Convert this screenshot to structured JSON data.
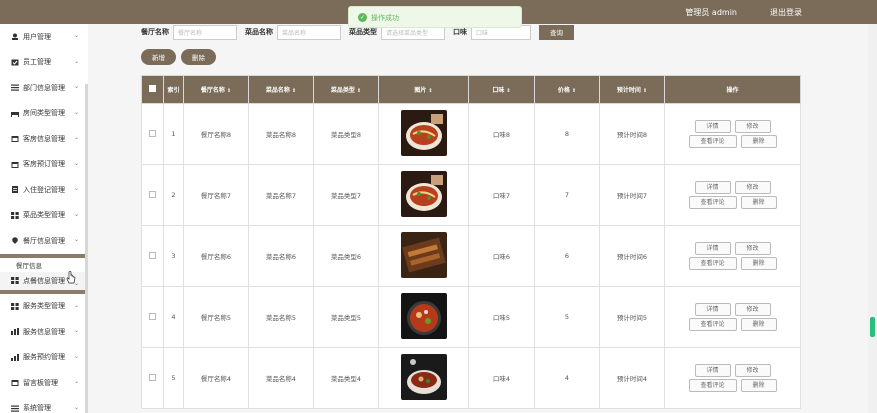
{
  "header": {
    "user_label": "管理员 admin",
    "logout_label": "退出登录"
  },
  "toast": {
    "message": "操作成功"
  },
  "sidebar": {
    "items": [
      {
        "label": "用户管理",
        "icon": "user-icon"
      },
      {
        "label": "员工管理",
        "icon": "check-icon"
      },
      {
        "label": "部门信息管理",
        "icon": "list-icon"
      },
      {
        "label": "房间类型管理",
        "icon": "bed-icon"
      },
      {
        "label": "客房信息管理",
        "icon": "calendar-icon"
      },
      {
        "label": "客房预订管理",
        "icon": "calendar-icon"
      },
      {
        "label": "入住登记管理",
        "icon": "doc-icon"
      },
      {
        "label": "菜品类型管理",
        "icon": "grid-icon"
      },
      {
        "label": "餐厅信息管理",
        "icon": "pin-icon"
      }
    ],
    "submenu": [
      {
        "label": "餐厅信息"
      }
    ],
    "active": {
      "label": "点餐信息管理",
      "icon": "grid-icon"
    },
    "items_after": [
      {
        "label": "服务类型管理",
        "icon": "grid-icon"
      },
      {
        "label": "服务信息管理",
        "icon": "chart-icon"
      },
      {
        "label": "服务预约管理",
        "icon": "bar-icon"
      },
      {
        "label": "留言板管理",
        "icon": "calendar-icon"
      },
      {
        "label": "系统管理",
        "icon": "list-icon"
      }
    ]
  },
  "search": {
    "fields": [
      {
        "label": "餐厅名称",
        "placeholder": "餐厅名称"
      },
      {
        "label": "菜品名称",
        "placeholder": "菜品名称"
      },
      {
        "label": "菜品类型",
        "placeholder": "请选择菜品类型"
      },
      {
        "label": "口味",
        "placeholder": "口味"
      }
    ],
    "button_label": "查询"
  },
  "actions": {
    "add_label": "新增",
    "delete_label": "删除"
  },
  "table": {
    "columns": [
      "索引",
      "餐厅名称",
      "菜品名称",
      "菜品类型",
      "图片",
      "口味",
      "价格",
      "预计时间",
      "操作"
    ],
    "rows": [
      {
        "index": "1",
        "restaurant": "餐厅名称8",
        "dish": "菜品名称8",
        "type": "菜品类型8",
        "taste": "口味8",
        "price": "8",
        "time": "预计时间8",
        "img": "noodle"
      },
      {
        "index": "2",
        "restaurant": "餐厅名称7",
        "dish": "菜品名称7",
        "type": "菜品类型7",
        "taste": "口味7",
        "price": "7",
        "time": "预计时间7",
        "img": "noodle"
      },
      {
        "index": "3",
        "restaurant": "餐厅名称6",
        "dish": "菜品名称6",
        "type": "菜品类型6",
        "taste": "口味6",
        "price": "6",
        "time": "预计时间6",
        "img": "skewer"
      },
      {
        "index": "4",
        "restaurant": "餐厅名称5",
        "dish": "菜品名称5",
        "type": "菜品类型5",
        "taste": "口味5",
        "price": "5",
        "time": "预计时间5",
        "img": "hotpot"
      },
      {
        "index": "5",
        "restaurant": "餐厅名称4",
        "dish": "菜品名称4",
        "type": "菜品类型4",
        "taste": "口味4",
        "price": "4",
        "time": "预计时间4",
        "img": "bowl"
      }
    ],
    "op_labels": {
      "detail": "详情",
      "edit": "修改",
      "review": "查看评论",
      "delete": "删除"
    }
  }
}
